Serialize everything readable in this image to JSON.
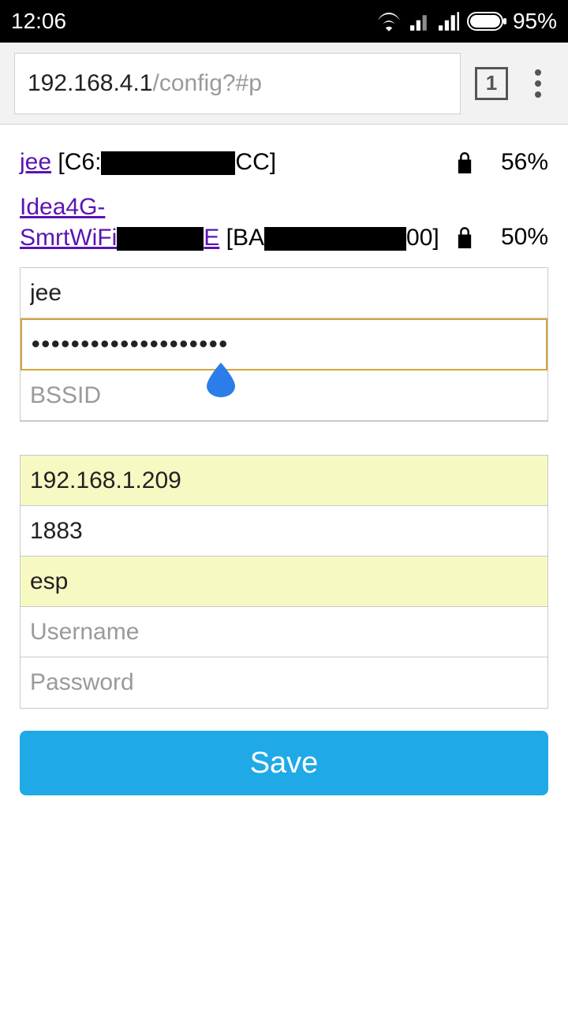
{
  "status": {
    "time": "12:06",
    "battery": "95%"
  },
  "browser": {
    "url_main": "192.168.4.1",
    "url_rest": "/config?#p",
    "tab_count": "1"
  },
  "networks": [
    {
      "ssid": "jee",
      "bssid_prefix": " [C6:",
      "bssid_suffix": "CC]",
      "signal": "56%"
    },
    {
      "ssid_a": "Idea4G-",
      "ssid_b": "SmrtWiFi",
      "ssid_after": "E",
      "bssid_prefix": " [BA",
      "bssid_suffix": "00]",
      "signal": "50%"
    }
  ],
  "form": {
    "ssid_value": "jee",
    "password_value": "••••••••••••••••••••",
    "bssid_placeholder": "BSSID",
    "ip_value": "192.168.1.209",
    "port_value": "1883",
    "client_value": "esp",
    "username_placeholder": "Username",
    "password2_placeholder": "Password",
    "save_label": "Save"
  }
}
